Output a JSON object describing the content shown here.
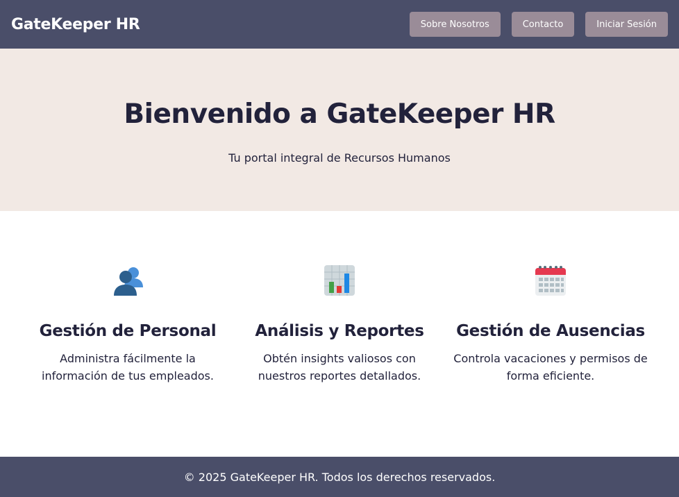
{
  "header": {
    "brand": "GateKeeper HR",
    "nav": [
      {
        "label": "Sobre Nosotros"
      },
      {
        "label": "Contacto"
      },
      {
        "label": "Iniciar Sesión"
      }
    ]
  },
  "hero": {
    "title": "Bienvenido a GateKeeper HR",
    "subtitle": "Tu portal integral de Recursos Humanos"
  },
  "features": [
    {
      "icon": "users-icon",
      "title": "Gestión de Personal",
      "description": "Administra fácilmente la información de tus empleados."
    },
    {
      "icon": "bar-chart-icon",
      "title": "Análisis y Reportes",
      "description": "Obtén insights valiosos con nuestros reportes detallados."
    },
    {
      "icon": "calendar-icon",
      "title": "Gestión de Ausencias",
      "description": "Controla vacaciones y permisos de forma eficiente."
    }
  ],
  "footer": {
    "text": "© 2025 GateKeeper HR. Todos los derechos reservados."
  },
  "colors": {
    "header_bg": "#4a4e69",
    "button_bg": "#9a8c98",
    "hero_bg": "#f2e9e4",
    "text": "#22223b"
  }
}
